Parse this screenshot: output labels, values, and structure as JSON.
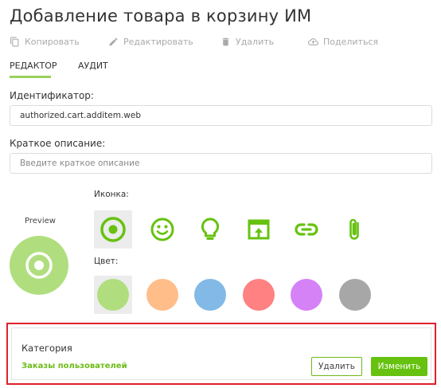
{
  "title": "Добавление товара в корзину ИМ",
  "toolbar": {
    "copy": "Копировать",
    "edit": "Редактировать",
    "delete": "Удалить",
    "share": "Поделиться"
  },
  "tabs": [
    {
      "label": "Редактор",
      "active": true
    },
    {
      "label": "Аудит",
      "active": false
    }
  ],
  "form": {
    "identifier_label": "Идентификатор:",
    "identifier_value": "authorized.cart.additem.web",
    "description_label": "Краткое описание:",
    "description_placeholder": "Введите краткое описание"
  },
  "preview": {
    "label": "Preview",
    "color": "#b0de7e",
    "icon": "radio-target-icon"
  },
  "icons": {
    "label": "Иконка:",
    "items": [
      "radio-target-icon",
      "smile-icon",
      "lightbulb-icon",
      "open-in-app-icon",
      "link-icon",
      "paperclip-icon"
    ],
    "selected_index": 0,
    "color": "#66c20f"
  },
  "colors": {
    "label": "Цвет:",
    "items": [
      "#b0de7e",
      "#ffbd8a",
      "#82b9e6",
      "#ff8181",
      "#d582f7",
      "#a7a7a7"
    ],
    "selected_index": 0
  },
  "category": {
    "title": "Категория",
    "value": "Заказы пользователей",
    "delete_button": "Удалить",
    "change_button": "Изменить",
    "accent": "#66c20f",
    "highlight_border": "#e0202c"
  }
}
